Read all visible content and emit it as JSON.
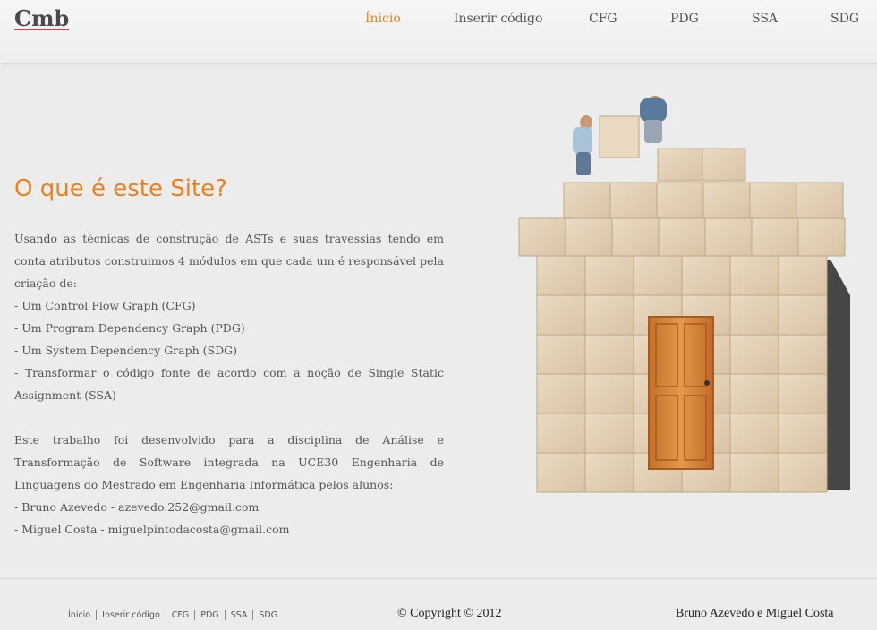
{
  "header": {
    "logo": "Cmb",
    "nav": [
      "Ínicio",
      "Inserir código",
      "CFG",
      "PDG",
      "SSA",
      "SDG"
    ],
    "active_item": "Ínicio"
  },
  "main": {
    "title": "O que é este Site?",
    "paragraph1": "Usando as técnicas de construção de ASTs e suas travessias tendo em conta atributos construimos 4 módulos em que cada um é responsável pela criação de:",
    "items": [
      "- Um Control Flow Graph (CFG)",
      "- Um Program Dependency Graph (PDG)",
      "- Um System Dependency Graph (SDG)",
      "- Transformar o código fonte de acordo com a noção de Single Static Assignment (SSA)"
    ],
    "paragraph2": "Este trabalho foi desenvolvido para a disciplina de Análise e Transformação de Software integrada na UCE30 Engenharia de Linguagens do Mestrado em Engenharia Informática pelos alunos:",
    "students": [
      "- Bruno Azevedo - azevedo.252@gmail.com",
      "- Miguel Costa - miguelpintodacosta@gmail.com"
    ]
  },
  "footer": {
    "nav": [
      "Ínicio",
      "Inserir código",
      "CFG",
      "PDG",
      "SSA",
      "SDG"
    ],
    "copyright": "© Copyright © 2012",
    "authors": "Bruno Azevedo e Miguel Costa"
  },
  "colors": {
    "accent": "#e8821e",
    "background": "#ececec",
    "box": "#e6d3b8",
    "door": "#d2832f"
  }
}
